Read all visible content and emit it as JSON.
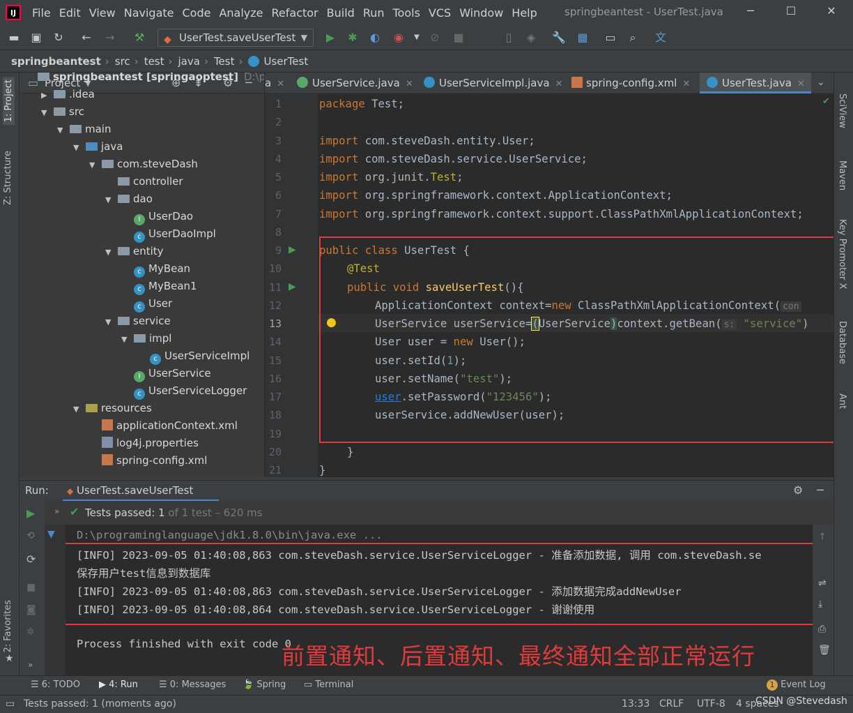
{
  "window": {
    "title": "springbeantest - UserTest.java",
    "logo_text": "IJ",
    "minimize": "─",
    "maximize": "☐",
    "close": "✕"
  },
  "menu": [
    "File",
    "Edit",
    "View",
    "Navigate",
    "Code",
    "Analyze",
    "Refactor",
    "Build",
    "Run",
    "Tools",
    "VCS",
    "Window",
    "Help"
  ],
  "toolbar": {
    "run_config": "UserTest.saveUserTest"
  },
  "breadcrumb": [
    "springbeantest",
    "src",
    "test",
    "java",
    "Test",
    "UserTest"
  ],
  "left_strip": {
    "project_tab": "1: Project",
    "structure_tab": "Z: Structure",
    "favorites_tab": "2: Favorites"
  },
  "right_strip": [
    "SciView",
    "Maven",
    "Key Promoter X",
    "Database",
    "Ant"
  ],
  "project_panel": {
    "title": "Project",
    "tree": [
      {
        "label": "springbeantest [springaoptest]",
        "suffix": "D:\\project",
        "type": "root",
        "depth": 0
      },
      {
        "label": ".idea",
        "type": "folder",
        "depth": 1,
        "twisty": "▶"
      },
      {
        "label": "src",
        "type": "folder",
        "depth": 1,
        "twisty": "▼"
      },
      {
        "label": "main",
        "type": "folder",
        "depth": 2,
        "twisty": "▼"
      },
      {
        "label": "java",
        "type": "src",
        "depth": 3,
        "twisty": "▼"
      },
      {
        "label": "com.steveDash",
        "type": "folder",
        "depth": 4,
        "twisty": "▼"
      },
      {
        "label": "controller",
        "type": "folder",
        "depth": 5,
        "twisty": ""
      },
      {
        "label": "dao",
        "type": "folder",
        "depth": 5,
        "twisty": "▼"
      },
      {
        "label": "UserDao",
        "type": "interface",
        "depth": 6
      },
      {
        "label": "UserDaoImpl",
        "type": "class",
        "depth": 6
      },
      {
        "label": "entity",
        "type": "folder",
        "depth": 5,
        "twisty": "▼"
      },
      {
        "label": "MyBean",
        "type": "class",
        "depth": 6
      },
      {
        "label": "MyBean1",
        "type": "class",
        "depth": 6
      },
      {
        "label": "User",
        "type": "class",
        "depth": 6
      },
      {
        "label": "service",
        "type": "folder",
        "depth": 5,
        "twisty": "▼"
      },
      {
        "label": "impl",
        "type": "folder",
        "depth": 6,
        "twisty": "▼"
      },
      {
        "label": "UserServiceImpl",
        "type": "class",
        "depth": 7
      },
      {
        "label": "UserService",
        "type": "interface",
        "depth": 6
      },
      {
        "label": "UserServiceLogger",
        "type": "class",
        "depth": 6
      },
      {
        "label": "resources",
        "type": "res",
        "depth": 3,
        "twisty": "▼"
      },
      {
        "label": "applicationContext.xml",
        "type": "xml",
        "depth": 4
      },
      {
        "label": "log4j.properties",
        "type": "prop",
        "depth": 4
      },
      {
        "label": "spring-config.xml",
        "type": "xml",
        "depth": 4
      }
    ]
  },
  "editor_tabs": [
    {
      "label": "a",
      "active": false
    },
    {
      "label": "UserService.java",
      "active": false
    },
    {
      "label": "UserServiceImpl.java",
      "active": false
    },
    {
      "label": "spring-config.xml",
      "active": false
    },
    {
      "label": "UserTest.java",
      "active": true
    }
  ],
  "editor": {
    "line_numbers": [
      "1",
      "2",
      "3",
      "4",
      "5",
      "6",
      "7",
      "8",
      "9",
      "10",
      "11",
      "12",
      "13",
      "14",
      "15",
      "16",
      "17",
      "18",
      "19",
      "20",
      "21"
    ],
    "current_line": "13",
    "lines": {
      "l1": [
        "package ",
        "Test;"
      ],
      "l3": [
        "import ",
        "com.steveDash.entity.User;"
      ],
      "l4": [
        "import ",
        "com.steveDash.service.UserService;"
      ],
      "l5": [
        "import ",
        "org.junit.",
        "Test",
        ";"
      ],
      "l6": [
        "import ",
        "org.springframework.context.ApplicationContext;"
      ],
      "l7": [
        "import ",
        "org.springframework.context.support.ClassPathXmlApplicationContext;"
      ],
      "l9": [
        "public class ",
        "UserTest {"
      ],
      "l10": [
        "@Test"
      ],
      "l11": [
        "public void ",
        "saveUserTest",
        "(){"
      ],
      "l12": [
        "ApplicationContext context=",
        "new ",
        "ClassPathXmlApplicationContext(",
        "con"
      ],
      "l13": [
        "UserService userService=",
        "(",
        "UserService",
        ")",
        "context.getBean(",
        "s:",
        "\"service\"",
        ")"
      ],
      "l14": [
        "User user = ",
        "new ",
        "User();"
      ],
      "l15": [
        "user.setId(",
        "1",
        ");"
      ],
      "l16": [
        "user.setName(",
        "\"test\"",
        ");"
      ],
      "l17": [
        "user",
        ".setPassword(",
        "\"123456\"",
        ");"
      ],
      "l18": [
        "userService.addNewUser(user);"
      ],
      "l20": [
        "}"
      ],
      "l21": [
        "}"
      ]
    }
  },
  "run_panel": {
    "label": "Run:",
    "tab": "UserTest.saveUserTest",
    "tests_passed": "Tests passed:",
    "tests_count": "1",
    "tests_detail": "of 1 test – 620 ms",
    "console": [
      "D:\\programinglanguage\\jdk1.8.0\\bin\\java.exe ...",
      "[INFO] 2023-09-05 01:40:08,863 com.steveDash.service.UserServiceLogger - 准备添加数据, 调用 com.steveDash.se",
      "保存用户test信息到数据库",
      "[INFO] 2023-09-05 01:40:08,863 com.steveDash.service.UserServiceLogger - 添加数据完成addNewUser",
      "[INFO] 2023-09-05 01:40:08,864 com.steveDash.service.UserServiceLogger - 谢谢使用",
      "",
      "Process finished with exit code 0"
    ],
    "overlay_caption": "前置通知、后置通知、最终通知全部正常运行"
  },
  "bottom_tabs": [
    "6: TODO",
    "4: Run",
    "0: Messages",
    "Spring",
    "Terminal"
  ],
  "event_log": {
    "count": "1",
    "label": "Event Log"
  },
  "status": {
    "message": "Tests passed: 1 (moments ago)",
    "position": "13:33",
    "line_sep": "CRLF",
    "encoding": "UTF-8",
    "indent": "4 spaces",
    "watermark": "CSDN @Stevedash"
  },
  "colors": {
    "accent": "#4a88c7",
    "annotation_box": "#e03b3b",
    "run_green": "#499c54"
  }
}
